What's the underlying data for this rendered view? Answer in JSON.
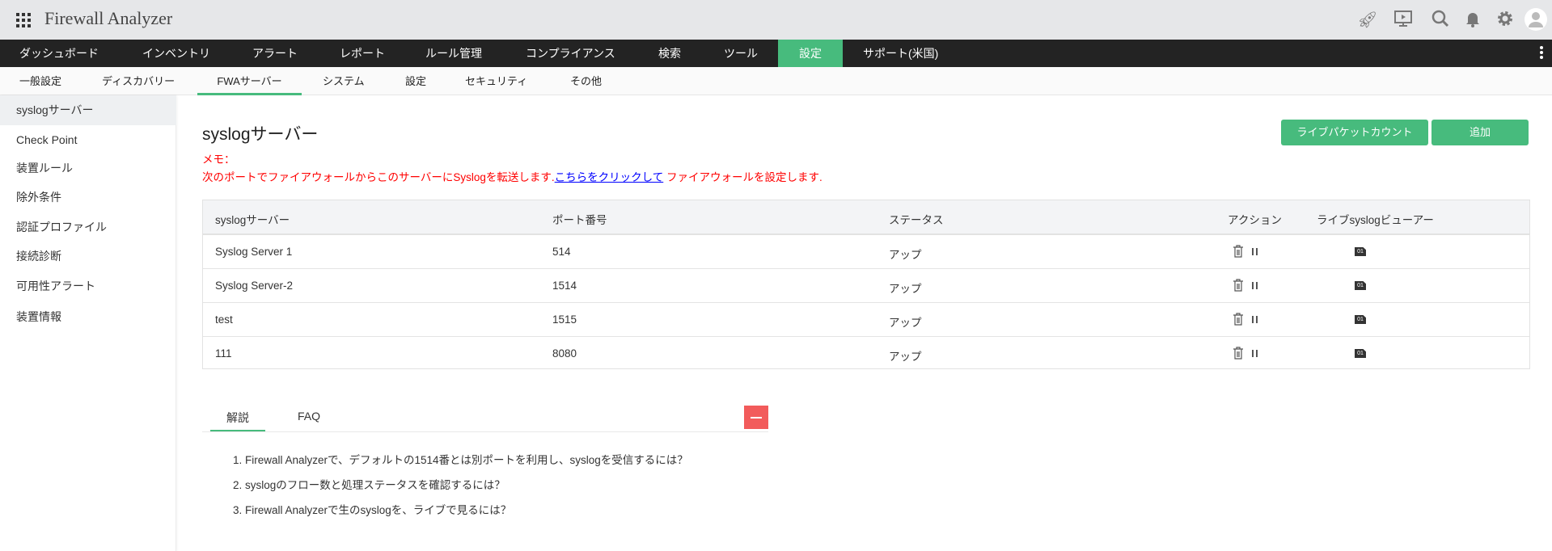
{
  "app": {
    "title": "Firewall Analyzer",
    "icons": [
      "rocket-icon",
      "presentation-icon",
      "search-icon",
      "bell-icon",
      "gear-icon",
      "user-avatar-icon"
    ]
  },
  "nav": {
    "items": [
      "ダッシュボード",
      "インベントリ",
      "アラート",
      "レポート",
      "ルール管理",
      "コンプライアンス",
      "検索",
      "ツール",
      "設定",
      "サポート(米国)"
    ],
    "active": "設定"
  },
  "subnav": {
    "items": [
      "一般設定",
      "ディスカバリー",
      "FWAサーバー",
      "システム",
      "設定",
      "セキュリティ",
      "その他"
    ],
    "active": "FWAサーバー"
  },
  "sidebar": {
    "items": [
      "syslogサーバー",
      "Check Point",
      "装置ルール",
      "除外条件",
      "認証プロファイル",
      "接続診断",
      "可用性アラート",
      "装置情報"
    ],
    "selected": "syslogサーバー"
  },
  "main": {
    "title": "syslogサーバー",
    "memo_label": "メモ：",
    "memo_before": "次のポートでファイアウォールからこのサーバーにSyslogを転送します.",
    "memo_link": "こちらをクリックして",
    "memo_after": " ファイアウォールを設定します.",
    "buttons": {
      "live_packet": "ライブパケットカウント",
      "add": "追加"
    }
  },
  "table": {
    "headers": [
      "syslogサーバー",
      "ポート番号",
      "ステータス",
      "アクション",
      "ライブsyslogビューアー"
    ],
    "rows": [
      {
        "server": "Syslog Server 1",
        "port": "514",
        "status": "アップ"
      },
      {
        "server": "Syslog Server-2",
        "port": "1514",
        "status": "アップ"
      },
      {
        "server": "test",
        "port": "1515",
        "status": "アップ"
      },
      {
        "server": "111",
        "port": "8080",
        "status": "アップ"
      }
    ],
    "viewer_glyph": "01"
  },
  "help": {
    "tabs": [
      "解説",
      "FAQ"
    ],
    "active": "解説",
    "items": [
      "1. Firewall Analyzerで、デフォルトの1514番とは別ポートを利用し、syslogを受信するには？",
      "2. syslogのフロー数と処理ステータスを確認するには？",
      "3. Firewall Analyzerで生のsyslogを、ライブで見るには？"
    ]
  },
  "colors": {
    "accent": "#47bb7d",
    "nav_bg": "#232323",
    "memo": "#ff0000",
    "collapse": "#f25b5b"
  }
}
